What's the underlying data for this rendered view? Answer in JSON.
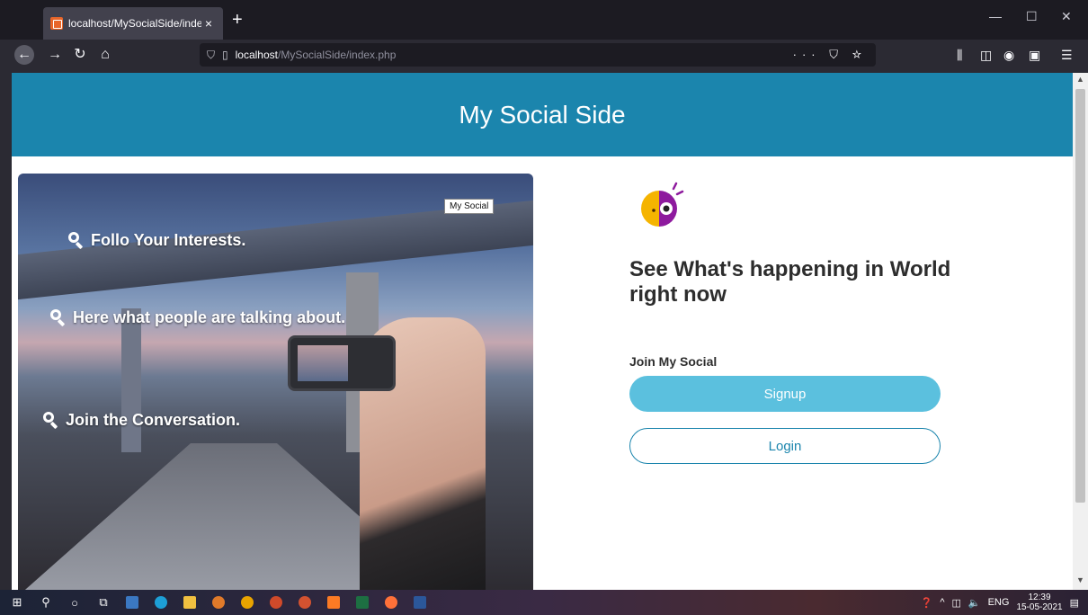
{
  "browser": {
    "tab_title": "localhost/MySocialSide/index.p",
    "tab_close": "×",
    "new_tab": "+",
    "url_host": "localhost",
    "url_path": "/MySocialSide/index.php",
    "url_actions": "··· ⛉ ☆",
    "window_controls": {
      "minimize": "—",
      "maximize": "☐",
      "close": "✕"
    }
  },
  "page": {
    "header_title": "My Social Side",
    "hero_label": "My Social",
    "features": [
      "Follo Your Interests.",
      "Here what people are talking about.",
      "Join the Conversation."
    ],
    "tagline": "See What's happening in World right now",
    "join_label": "Join My Social",
    "signup_label": "Signup",
    "login_label": "Login"
  },
  "taskbar": {
    "language": "ENG",
    "time": "12:39",
    "date": "15-05-2021"
  },
  "colors": {
    "header": "#1b85ad",
    "signup": "#5bc0de",
    "login_border": "#1b85ad",
    "logo_yellow": "#f5b400",
    "logo_purple": "#8e1a9e"
  }
}
